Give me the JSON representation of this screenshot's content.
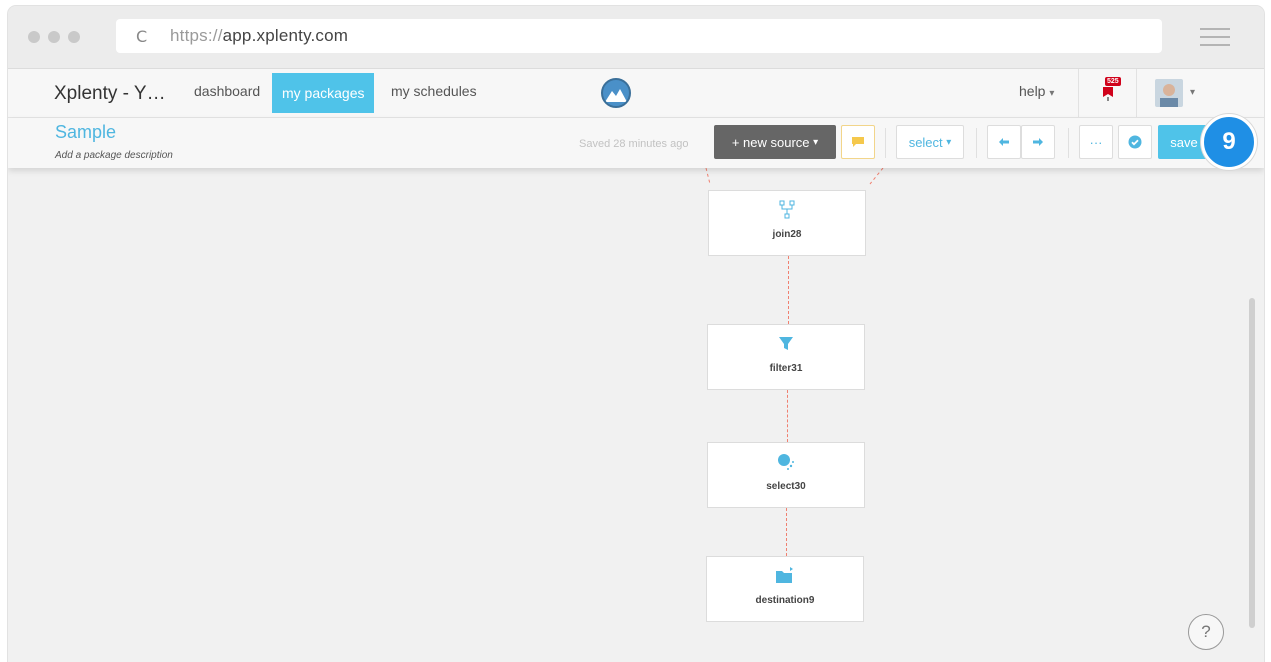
{
  "browser": {
    "url_protocol": "https://",
    "url_host": "app.xplenty.com"
  },
  "nav": {
    "brand": "Xplenty - Y…",
    "items": [
      {
        "label": "dashboard",
        "active": false
      },
      {
        "label": "my packages",
        "active": true
      },
      {
        "label": "my schedules",
        "active": false
      }
    ],
    "help": "help",
    "notification_count": "525"
  },
  "package": {
    "title": "Sample",
    "description_placeholder": "Add a package description",
    "saved_status": "Saved 28 minutes ago"
  },
  "toolbar": {
    "new_source": "+ new source",
    "select": "select",
    "more": "···",
    "save": "save"
  },
  "step_badge": "9",
  "pipeline": [
    {
      "label": "join28",
      "icon": "join-icon"
    },
    {
      "label": "filter31",
      "icon": "filter-icon"
    },
    {
      "label": "select30",
      "icon": "select-icon"
    },
    {
      "label": "destination9",
      "icon": "destination-folder-icon"
    }
  ],
  "help_button": "?",
  "colors": {
    "accent": "#4fc3e9",
    "connector": "#f08070",
    "badge": "#1f8fe5"
  }
}
